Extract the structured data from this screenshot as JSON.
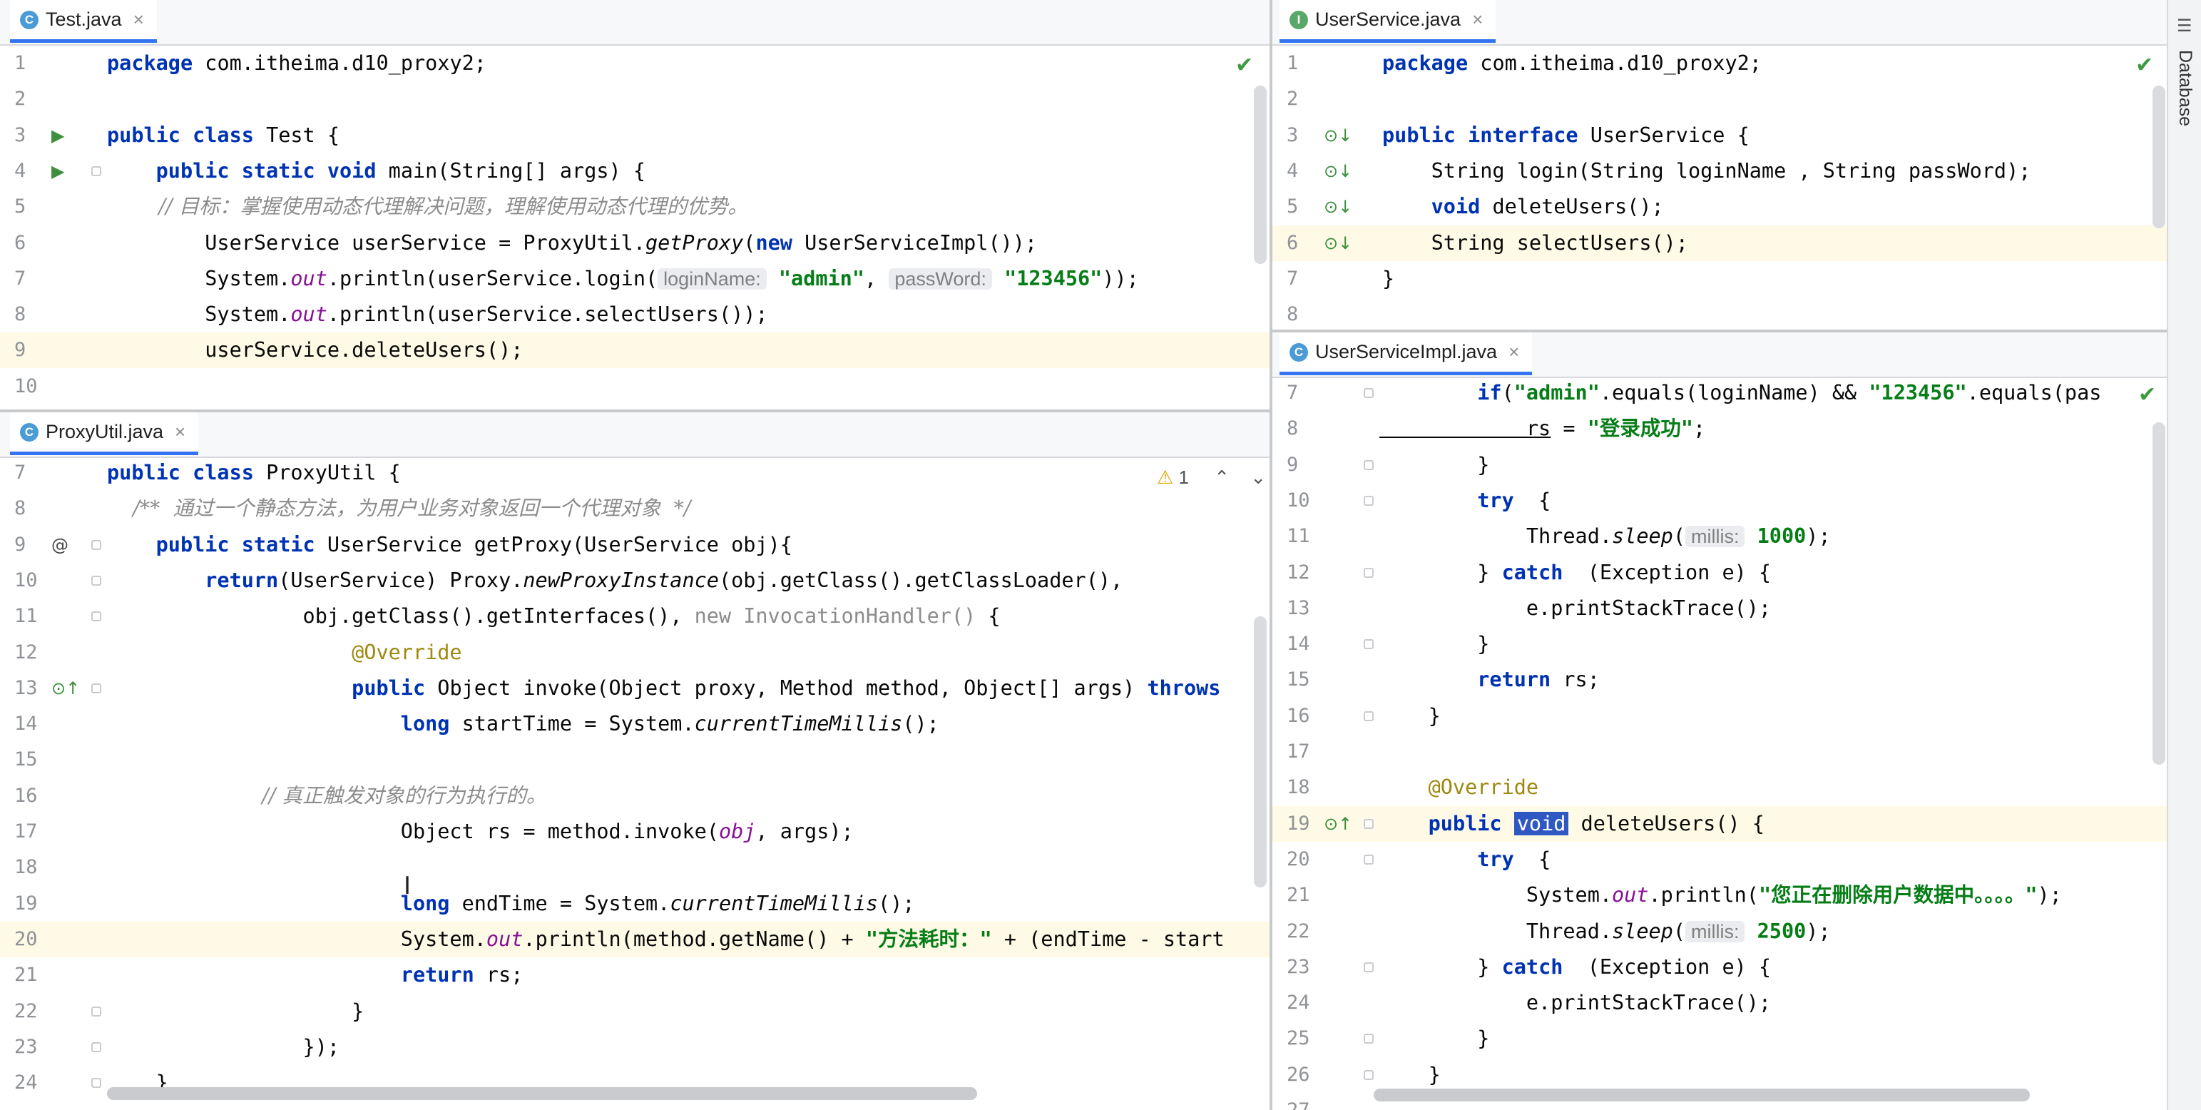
{
  "sidebar": {
    "label": "Database"
  },
  "panes": {
    "test": {
      "tab_label": "Test.java",
      "lines": [
        {
          "n": "1",
          "t": [
            [
              "kw",
              "package"
            ],
            [
              "",
              "com.itheima.d10_proxy2;"
            ]
          ]
        },
        {
          "n": "2",
          "t": []
        },
        {
          "n": "3",
          "t": [
            [
              "kw",
              "public class"
            ],
            [
              "",
              "Test {"
            ]
          ]
        },
        {
          "n": "4",
          "t": [
            [
              "kw",
              "    public static void"
            ],
            [
              "",
              "main(String[] args) {"
            ]
          ]
        },
        {
          "n": "5",
          "t": [
            [
              "cm",
              "        // 目标：掌握使用动态代理解决问题，理解使用动态代理的优势。"
            ]
          ]
        },
        {
          "n": "6",
          "t": [
            [
              "",
              "        UserService userService = ProxyUtil."
            ],
            [
              "it",
              "getProxy"
            ],
            [
              "",
              "("
            ],
            [
              "kw",
              "new"
            ],
            [
              "",
              "UserServiceImpl());"
            ]
          ]
        },
        {
          "n": "7",
          "t": [
            [
              "",
              "        System."
            ],
            [
              "fld",
              "out"
            ],
            [
              "",
              ".println(userService.login("
            ],
            [
              "hint",
              "loginName:"
            ],
            [
              "str",
              " \"admin\""
            ],
            [
              "",
              ", "
            ],
            [
              "hint",
              "passWord:"
            ],
            [
              "str",
              " \"123456\""
            ],
            [
              "",
              "));"
            ]
          ]
        },
        {
          "n": "8",
          "t": [
            [
              "",
              "        System."
            ],
            [
              "fld",
              "out"
            ],
            [
              "",
              ".println(userService.selectUsers());"
            ]
          ]
        },
        {
          "n": "9",
          "t": [
            [
              "",
              "        userService.deleteUsers();"
            ]
          ]
        },
        {
          "n": "10",
          "t": []
        }
      ]
    },
    "proxy": {
      "tab_label": "ProxyUtil.java",
      "warning_count": "1",
      "lines": [
        {
          "n": "7",
          "t": [
            [
              "kw",
              "public class"
            ],
            [
              "",
              "ProxyUtil {"
            ]
          ]
        },
        {
          "n": "8",
          "t": [
            [
              "cm",
              "    /**  通过一个静态方法，为用户业务对象返回一个代理对象  */"
            ]
          ]
        },
        {
          "n": "9",
          "t": [
            [
              "kw",
              "    public static"
            ],
            [
              "",
              "UserService getProxy(UserService obj){"
            ]
          ]
        },
        {
          "n": "10",
          "t": [
            [
              "kw",
              "        return"
            ],
            [
              "",
              "(UserService) Proxy."
            ],
            [
              "it",
              "newProxyInstance"
            ],
            [
              "",
              "(obj.getClass().getClassLoader(),"
            ]
          ]
        },
        {
          "n": "11",
          "t": [
            [
              "",
              "                obj.getClass().getInterfaces(), "
            ],
            [
              "gray",
              "new InvocationHandler()"
            ],
            [
              "",
              " {"
            ]
          ]
        },
        {
          "n": "12",
          "t": [
            [
              "ann",
              "                    @Override"
            ]
          ]
        },
        {
          "n": "13",
          "t": [
            [
              "kw",
              "                    public"
            ],
            [
              "",
              "Object invoke(Object proxy, Method method, Object[] args) "
            ],
            [
              "kw",
              "throws"
            ]
          ]
        },
        {
          "n": "14",
          "t": [
            [
              "kw",
              "                        long"
            ],
            [
              "",
              "startTime = System."
            ],
            [
              "it",
              "currentTimeMillis"
            ],
            [
              "",
              "();"
            ]
          ]
        },
        {
          "n": "15",
          "t": []
        },
        {
          "n": "16",
          "t": [
            [
              "cm",
              "                        // 真正触发对象的行为执行的。"
            ]
          ]
        },
        {
          "n": "17",
          "t": [
            [
              "",
              "                        Object rs = method.invoke("
            ],
            [
              "fld",
              "obj"
            ],
            [
              "",
              ", args);"
            ]
          ]
        },
        {
          "n": "18",
          "t": []
        },
        {
          "n": "19",
          "t": [
            [
              "kw",
              "                        long"
            ],
            [
              "",
              "endTime = System."
            ],
            [
              "it",
              "currentTimeMillis"
            ],
            [
              "",
              "();"
            ]
          ]
        },
        {
          "n": "20",
          "t": [
            [
              "",
              "                        System."
            ],
            [
              "fld",
              "out"
            ],
            [
              "",
              ".println(method.getName() + "
            ],
            [
              "str",
              "\"方法耗时：\""
            ],
            [
              "",
              " + (endTime - start"
            ]
          ]
        },
        {
          "n": "21",
          "t": [
            [
              "kw",
              "                        return"
            ],
            [
              "",
              "rs;"
            ]
          ]
        },
        {
          "n": "22",
          "t": [
            [
              "",
              "                    }"
            ]
          ]
        },
        {
          "n": "23",
          "t": [
            [
              "",
              "                });"
            ]
          ]
        },
        {
          "n": "24",
          "t": [
            [
              "",
              "    }"
            ]
          ]
        }
      ]
    },
    "userservice": {
      "tab_label": "UserService.java",
      "lines": [
        {
          "n": "1",
          "t": [
            [
              "kw",
              "package"
            ],
            [
              "",
              "com.itheima.d10_proxy2;"
            ]
          ]
        },
        {
          "n": "2",
          "t": []
        },
        {
          "n": "3",
          "t": [
            [
              "kw",
              "public interface"
            ],
            [
              "",
              "UserService {"
            ]
          ]
        },
        {
          "n": "4",
          "t": [
            [
              "",
              "    String login(String loginName , String passWord);"
            ]
          ]
        },
        {
          "n": "5",
          "t": [
            [
              "kw",
              "    void"
            ],
            [
              "",
              "deleteUsers();"
            ]
          ]
        },
        {
          "n": "6",
          "t": [
            [
              "",
              "    String selectUsers();"
            ]
          ]
        },
        {
          "n": "7",
          "t": [
            [
              "",
              "}"
            ]
          ]
        },
        {
          "n": "8",
          "t": []
        }
      ]
    },
    "impl": {
      "tab_label": "UserServiceImpl.java",
      "lines": [
        {
          "n": "7",
          "t": [
            [
              "kw",
              "        if"
            ],
            [
              "",
              "("
            ],
            [
              "str",
              "\"admin\""
            ],
            [
              "",
              ".equals(loginName) && "
            ],
            [
              "str",
              "\"123456\""
            ],
            [
              "",
              ".equals(pas"
            ]
          ]
        },
        {
          "n": "8",
          "t": [
            [
              "und",
              "            rs"
            ],
            [
              "",
              " = "
            ],
            [
              "str",
              "\"登录成功\""
            ],
            [
              "",
              ";"
            ]
          ]
        },
        {
          "n": "9",
          "t": [
            [
              "",
              "        }"
            ]
          ]
        },
        {
          "n": "10",
          "t": [
            [
              "kw",
              "        try"
            ],
            [
              "",
              " {"
            ]
          ]
        },
        {
          "n": "11",
          "t": [
            [
              "",
              "            Thread."
            ],
            [
              "it",
              "sleep"
            ],
            [
              "",
              "("
            ],
            [
              "hint",
              "millis:"
            ],
            [
              "str",
              " 1000"
            ],
            [
              "",
              ");"
            ]
          ]
        },
        {
          "n": "12",
          "t": [
            [
              "",
              "        } "
            ],
            [
              "kw",
              "catch"
            ],
            [
              "",
              " (Exception e) {"
            ]
          ]
        },
        {
          "n": "13",
          "t": [
            [
              "",
              "            e.printStackTrace();"
            ]
          ]
        },
        {
          "n": "14",
          "t": [
            [
              "",
              "        }"
            ]
          ]
        },
        {
          "n": "15",
          "t": [
            [
              "kw",
              "        return"
            ],
            [
              "",
              "rs;"
            ]
          ]
        },
        {
          "n": "16",
          "t": [
            [
              "",
              "    }"
            ]
          ]
        },
        {
          "n": "17",
          "t": []
        },
        {
          "n": "18",
          "t": [
            [
              "ann",
              "    @Override"
            ]
          ]
        },
        {
          "n": "19",
          "t": [
            [
              "kw",
              "    public"
            ],
            [
              "sel",
              "void"
            ],
            [
              "",
              "deleteUsers() {"
            ]
          ]
        },
        {
          "n": "20",
          "t": [
            [
              "kw",
              "        try"
            ],
            [
              "",
              " {"
            ]
          ]
        },
        {
          "n": "21",
          "t": [
            [
              "",
              "            System."
            ],
            [
              "fld",
              "out"
            ],
            [
              "",
              ".println("
            ],
            [
              "str",
              "\"您正在删除用户数据中。。。。\""
            ],
            [
              "",
              ");"
            ]
          ]
        },
        {
          "n": "22",
          "t": [
            [
              "",
              "            Thread."
            ],
            [
              "it",
              "sleep"
            ],
            [
              "",
              "("
            ],
            [
              "hint",
              "millis:"
            ],
            [
              "str",
              " 2500"
            ],
            [
              "",
              ");"
            ]
          ]
        },
        {
          "n": "23",
          "t": [
            [
              "",
              "        } "
            ],
            [
              "kw",
              "catch"
            ],
            [
              "",
              " (Exception e) {"
            ]
          ]
        },
        {
          "n": "24",
          "t": [
            [
              "",
              "            e.printStackTrace();"
            ]
          ]
        },
        {
          "n": "25",
          "t": [
            [
              "",
              "        }"
            ]
          ]
        },
        {
          "n": "26",
          "t": [
            [
              "",
              "    }"
            ]
          ]
        },
        {
          "n": "27",
          "t": []
        }
      ]
    }
  }
}
